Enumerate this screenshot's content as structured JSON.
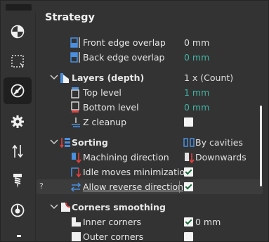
{
  "panel": {
    "title": "Strategy"
  },
  "rows": {
    "front_edge": {
      "label": "Front edge overlap",
      "value": "0 mm"
    },
    "back_edge": {
      "label": "Back edge overlap",
      "value": "0 mm"
    },
    "layers": {
      "label": "Layers (depth)",
      "value": "1 x (Count)"
    },
    "top_level": {
      "label": "Top level",
      "value": "1 mm"
    },
    "bottom_level": {
      "label": "Bottom level",
      "value": "0 mm"
    },
    "z_cleanup": {
      "label": "Z cleanup",
      "checked": false
    },
    "sorting": {
      "label": "Sorting",
      "value": "By cavities"
    },
    "machining_direction": {
      "label": "Machining direction",
      "value": "Downwards"
    },
    "idle_moves": {
      "label": "Idle moves minimization",
      "checked": true
    },
    "allow_reverse": {
      "label": "Allow reverse direction",
      "checked": true,
      "help": "?"
    },
    "corners_smoothing": {
      "label": "Corners smoothing"
    },
    "inner_corners": {
      "label": "Inner corners",
      "checked": true,
      "value": "0 mm"
    },
    "outer_corners": {
      "label": "Outer corners",
      "checked": false
    }
  },
  "sidebar": {
    "items": [
      {
        "icon": "material-sphere-icon"
      },
      {
        "icon": "dashed-selection-icon"
      },
      {
        "icon": "strategy-compass-icon",
        "active": true
      },
      {
        "icon": "gear-icon"
      },
      {
        "icon": "up-down-arrows-icon"
      },
      {
        "icon": "drill-tool-icon"
      },
      {
        "icon": "disc-icon"
      }
    ]
  },
  "colors": {
    "accent_teal": "#3fb4a4",
    "icon_blue": "#4a8fe0",
    "icon_red": "#e04040"
  }
}
